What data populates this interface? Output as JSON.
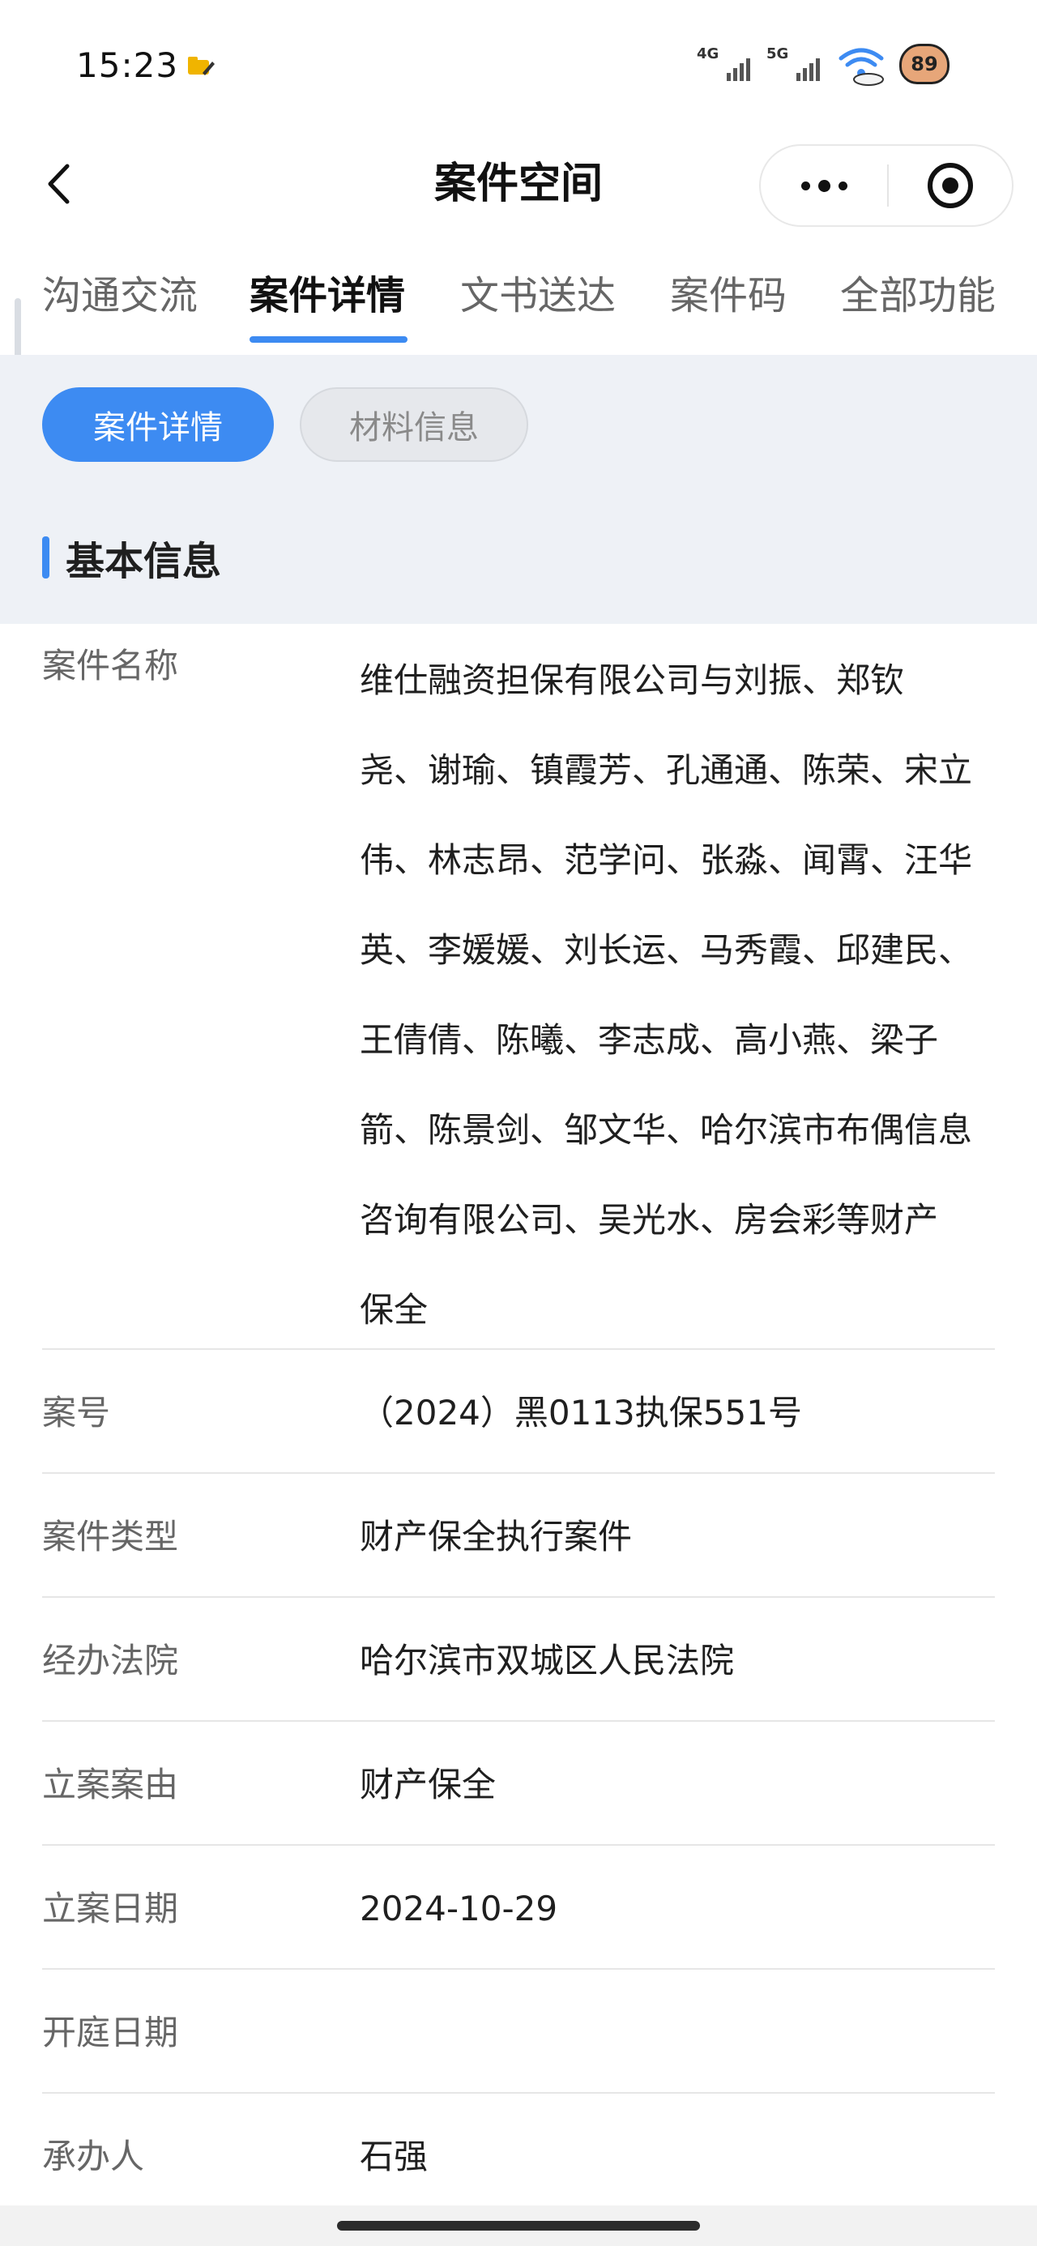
{
  "status_bar": {
    "time": "15:23",
    "network_1": "4G",
    "network_2": "5G",
    "battery": "89"
  },
  "nav": {
    "title": "案件空间"
  },
  "tabs": [
    {
      "label": "沟通交流",
      "active": false
    },
    {
      "label": "案件详情",
      "active": true
    },
    {
      "label": "文书送达",
      "active": false
    },
    {
      "label": "案件码",
      "active": false
    },
    {
      "label": "全部功能",
      "active": false
    }
  ],
  "sub_tabs": [
    {
      "label": "案件详情",
      "active": true
    },
    {
      "label": "材料信息",
      "active": false
    }
  ],
  "section": {
    "title": "基本信息"
  },
  "details": [
    {
      "label": "案件名称",
      "value": "维仕融资担保有限公司与刘振、郑钦尧、谢瑜、镇霞芳、孔通通、陈荣、宋立伟、林志昂、范学问、张淼、闻霄、汪华英、李媛媛、刘长运、马秀霞、邱建民、王倩倩、陈曦、李志成、高小燕、梁子箭、陈景剑、邹文华、哈尔滨市布偶信息咨询有限公司、吴光水、房会彩等财产保全"
    },
    {
      "label": "案号",
      "value": "（2024）黑0113执保551号"
    },
    {
      "label": "案件类型",
      "value": "财产保全执行案件"
    },
    {
      "label": "经办法院",
      "value": "哈尔滨市双城区人民法院"
    },
    {
      "label": "立案案由",
      "value": "财产保全"
    },
    {
      "label": "立案日期",
      "value": "2024-10-29"
    },
    {
      "label": "开庭日期",
      "value": ""
    },
    {
      "label": "承办人",
      "value": "石强"
    }
  ],
  "case_name_lines": [
    "维仕融资担保有限公司与刘振、郑钦",
    "尧、谢瑜、镇霞芳、孔通通、陈荣、宋立",
    "伟、林志昂、范学问、张淼、闻霄、汪华",
    "英、李媛媛、刘长运、马秀霞、邱建民、",
    "王倩倩、陈曦、李志成、高小燕、梁子",
    "箭、陈景剑、邹文华、哈尔滨市布偶信息",
    "咨询有限公司、吴光水、房会彩等财产",
    "保全"
  ]
}
